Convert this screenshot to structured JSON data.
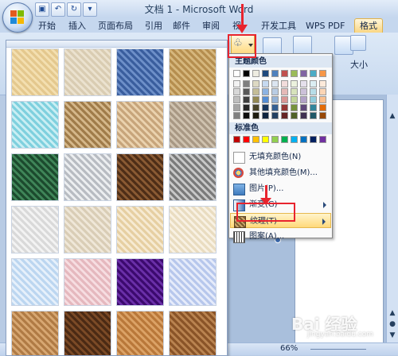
{
  "window": {
    "title": "文档 1 - Microsoft Word"
  },
  "tabs": [
    "开始",
    "插入",
    "页面布局",
    "引用",
    "邮件",
    "审阅",
    "视",
    "开发工具",
    "WPS PDF",
    "格式"
  ],
  "ribbon": {
    "size_label": "大小"
  },
  "fill_menu": {
    "theme_colors_label": "主题颜色",
    "standard_colors_label": "标准色",
    "theme_top_row": [
      "#ffffff",
      "#000000",
      "#eeece1",
      "#1f497d",
      "#4f81bd",
      "#c0504d",
      "#9bbb59",
      "#8064a2",
      "#4bacc6",
      "#f79646"
    ],
    "theme_shades": [
      [
        "#f2f2f2",
        "#7f7f7f",
        "#ddd9c3",
        "#c6d9f0",
        "#dbe5f1",
        "#f2dcdb",
        "#ebf1dd",
        "#e5e0ec",
        "#dbeef3",
        "#fdeada"
      ],
      [
        "#d8d8d8",
        "#595959",
        "#c4bd97",
        "#8db3e2",
        "#b8cce4",
        "#e5b9b7",
        "#d7e3bc",
        "#ccc1d9",
        "#b7dde8",
        "#fbd5b5"
      ],
      [
        "#bfbfbf",
        "#3f3f3f",
        "#938953",
        "#548dd4",
        "#95b3d7",
        "#d99694",
        "#c3d69b",
        "#b2a2c7",
        "#92cddc",
        "#fac08f"
      ],
      [
        "#a5a5a5",
        "#262626",
        "#494429",
        "#17365d",
        "#366092",
        "#953734",
        "#76923c",
        "#5f497a",
        "#31859b",
        "#e36c09"
      ],
      [
        "#7f7f7f",
        "#0c0c0c",
        "#1d1b10",
        "#0f243e",
        "#244061",
        "#632423",
        "#4f6128",
        "#3f3151",
        "#205867",
        "#974806"
      ]
    ],
    "standard_colors": [
      "#c00000",
      "#ff0000",
      "#ffc000",
      "#ffff00",
      "#92d050",
      "#00b050",
      "#00b0f0",
      "#0070c0",
      "#002060",
      "#7030a0"
    ],
    "items": [
      {
        "label": "无填充颜色(N)",
        "icon": "no-fill-icon",
        "submenu": false
      },
      {
        "label": "其他填充颜色(M)...",
        "icon": "palette-icon",
        "submenu": false
      },
      {
        "label": "图片(P)...",
        "icon": "picture-icon",
        "submenu": false
      },
      {
        "label": "渐变(G)",
        "icon": "gradient-icon",
        "submenu": true
      },
      {
        "label": "纹理(T)",
        "icon": "texture-icon",
        "submenu": true,
        "highlighted": true
      },
      {
        "label": "图案(A)...",
        "icon": "pattern-icon",
        "submenu": false
      }
    ]
  },
  "textures": [
    {
      "name": "纸莎草纸",
      "c1": "#e4c88e",
      "c2": "#f3dfb0"
    },
    {
      "name": "画布",
      "c1": "#d9ccb2",
      "c2": "#ebe2cf"
    },
    {
      "name": "斜纹布",
      "c1": "#3a5e9e",
      "c2": "#6d8fc8"
    },
    {
      "name": "粗麻布",
      "c1": "#b58e4f",
      "c2": "#d6b77d"
    },
    {
      "name": "水滴",
      "c1": "#7fd0de",
      "c2": "#c9eef3"
    },
    {
      "name": "纸袋",
      "c1": "#a07c4a",
      "c2": "#d4b78a"
    },
    {
      "name": "鱼类化石",
      "c1": "#c7a57b",
      "c2": "#ead2ae"
    },
    {
      "name": "沙滩",
      "c1": "#a89884",
      "c2": "#cfc2af"
    },
    {
      "name": "绿色大理石",
      "c1": "#1c4a2e",
      "c2": "#3f8558"
    },
    {
      "name": "白色大理石",
      "c1": "#b8bcc2",
      "c2": "#eceef0"
    },
    {
      "name": "棕色大理石",
      "c1": "#4e2e17",
      "c2": "#8a5a33"
    },
    {
      "name": "花岗岩",
      "c1": "#7a7a7a",
      "c2": "#c8c8c8"
    },
    {
      "name": "新闻纸",
      "c1": "#d9d9d9",
      "c2": "#f3f3f3"
    },
    {
      "name": "再生纸",
      "c1": "#d9cdb6",
      "c2": "#efe7d8"
    },
    {
      "name": "羊皮纸",
      "c1": "#e6cfa2",
      "c2": "#f6ead2"
    },
    {
      "name": "信纸",
      "c1": "#e9dcc0",
      "c2": "#f8f1e3"
    },
    {
      "name": "蓝色面巾纸",
      "c1": "#bcd6f0",
      "c2": "#e6f0fb"
    },
    {
      "name": "粉色面巾纸",
      "c1": "#e5b8be",
      "c2": "#f6dde1"
    },
    {
      "name": "紫色网格",
      "c1": "#3c0a6e",
      "c2": "#6a2fa8"
    },
    {
      "name": "花束",
      "c1": "#b7c7ec",
      "c2": "#e5ebfa"
    },
    {
      "name": "软木塞",
      "c1": "#b07b45",
      "c2": "#d7a772"
    },
    {
      "name": "胡桃",
      "c1": "#4b2a14",
      "c2": "#7b4a26"
    },
    {
      "name": "橡木",
      "c1": "#b9783a",
      "c2": "#dba266"
    },
    {
      "name": "中等木纹",
      "c1": "#8a5428",
      "c2": "#b98350"
    }
  ],
  "status": {
    "zoom": "66%"
  },
  "watermark": {
    "text": "Bai 经验",
    "sub": "jingyan.baidu.com"
  }
}
